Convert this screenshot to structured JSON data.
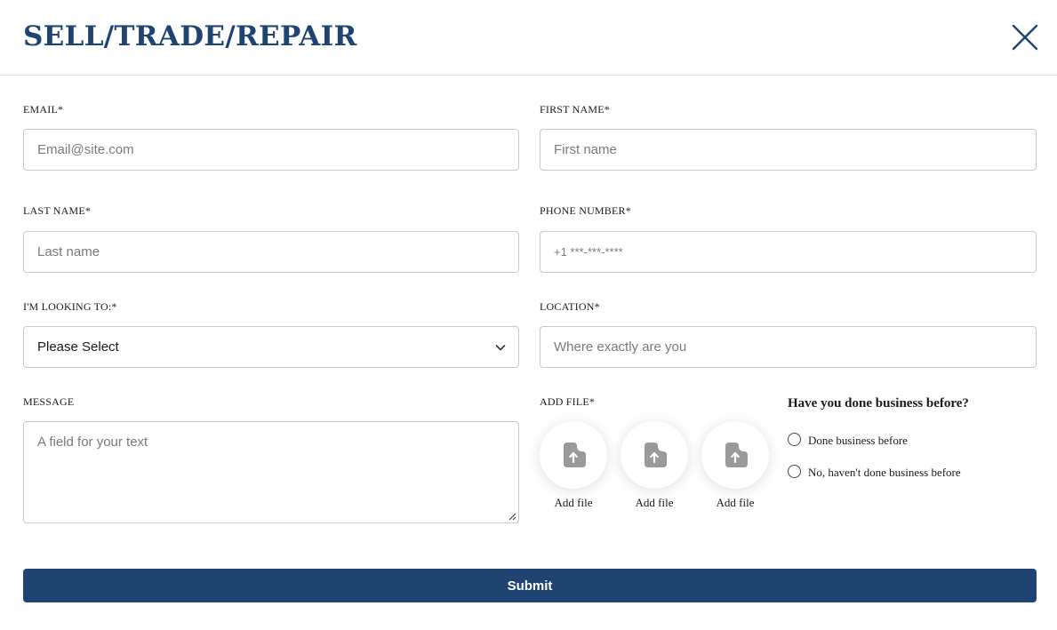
{
  "header": {
    "title": "SELL/TRADE/REPAIR",
    "close_icon": "close-icon"
  },
  "form": {
    "email": {
      "label": "EMAIL*",
      "placeholder": "Email@site.com",
      "value": ""
    },
    "first_name": {
      "label": "FIRST NAME*",
      "placeholder": "First name",
      "value": ""
    },
    "last_name": {
      "label": "LAST NAME*",
      "placeholder": "Last name",
      "value": ""
    },
    "phone": {
      "label": "PHONE NUMBER*",
      "placeholder": "+1 ***-***-****",
      "value": ""
    },
    "looking_to": {
      "label": "I'M LOOKING TO:*",
      "selected": "Please Select",
      "icon": "chevron-down-icon"
    },
    "location": {
      "label": "LOCATION*",
      "placeholder": "Where exactly are you",
      "value": ""
    },
    "message": {
      "label": "MESSAGE",
      "placeholder": "A field for your text",
      "value": ""
    },
    "add_file": {
      "label": "ADD FILE*",
      "icon": "upload-file-icon",
      "items": [
        {
          "label": "Add file"
        },
        {
          "label": "Add file"
        },
        {
          "label": "Add file"
        }
      ]
    },
    "business_before": {
      "question": "Have you done business before?",
      "options": [
        {
          "label": "Done business before",
          "checked": false
        },
        {
          "label": "No, haven't done business before",
          "checked": false
        }
      ]
    },
    "submit_label": "Submit"
  },
  "colors": {
    "brand": "#1f4471",
    "border": "#c9c9c9",
    "file_icon": "#9a9a9a"
  }
}
